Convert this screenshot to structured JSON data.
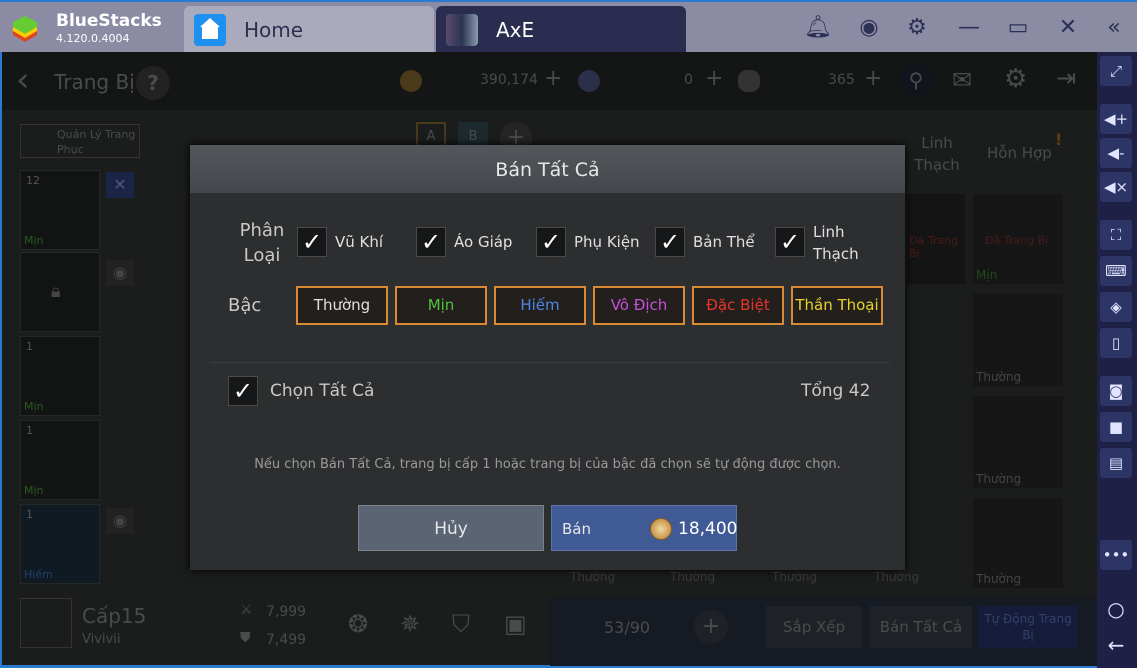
{
  "app": {
    "name": "BlueStacks",
    "version": "4.120.0.4004"
  },
  "tabs": [
    {
      "label": "Home"
    },
    {
      "label": "AxE"
    }
  ],
  "titlebar_icons": [
    "bell-icon",
    "account-icon",
    "gear-icon",
    "minimize-icon",
    "maximize-icon",
    "close-icon",
    "collapse-icon"
  ],
  "game": {
    "title": "Trang Bị",
    "help": "?",
    "gold": "390,174",
    "gems": "0",
    "stones": "365",
    "costume_button": "Quản Lý Trang Phục",
    "preset_tabs": [
      "A",
      "B"
    ],
    "category_tabs": [
      "Linh Thạch",
      "Hỗn Hợp"
    ],
    "equipped_slots": [
      {
        "count": "12",
        "grade": "Mịn"
      },
      {
        "count": "",
        "grade": ""
      },
      {
        "count": "1",
        "grade": "Mịn"
      },
      {
        "count": "1",
        "grade": "Mịn"
      },
      {
        "count": "1",
        "grade": "Hiếm"
      }
    ],
    "inventory_labels": [
      "Đã Trang Bị",
      "Đã Trang Bị",
      "Mịn",
      "Thường",
      "Thường",
      "Thường",
      "Thường",
      "Thường",
      "Thường",
      "Thường"
    ],
    "player": {
      "level": "Cấp15",
      "name": "Vivivii",
      "attack": "7,999",
      "defense": "7,499"
    },
    "capacity": "53/90",
    "sort_button": "Sắp Xếp",
    "sell_all_button": "Bán Tất Cả",
    "auto_equip_button": "Tự Động Trang Bị"
  },
  "dialog": {
    "title": "Bán Tất Cả",
    "category_label": "Phân Loại",
    "categories": [
      {
        "label": "Vũ Khí",
        "checked": true
      },
      {
        "label": "Áo Giáp",
        "checked": true
      },
      {
        "label": "Phụ Kiện",
        "checked": true
      },
      {
        "label": "Bản Thể",
        "checked": true
      },
      {
        "label": "Linh Thạch",
        "checked": true
      }
    ],
    "grade_label": "Bậc",
    "grades": [
      {
        "label": "Thường",
        "color": "#e0e0e0"
      },
      {
        "label": "Mịn",
        "color": "#4fc23c"
      },
      {
        "label": "Hiếm",
        "color": "#4d86e8"
      },
      {
        "label": "Vô Địch",
        "color": "#c84fd8"
      },
      {
        "label": "Đặc Biệt",
        "color": "#e8352c"
      },
      {
        "label": "Thần Thoại",
        "color": "#e8d22a"
      }
    ],
    "select_all": {
      "label": "Chọn Tất Cả",
      "checked": true
    },
    "total": "Tổng 42",
    "note": "Nếu chọn Bán Tất Cả, trang bị cấp 1 hoặc trang bị của bậc đã chọn sẽ tự động được chọn.",
    "cancel": "Hủy",
    "sell": "Bán",
    "sell_price": "18,400"
  },
  "sidebar_icons": [
    "fullscreen-icon",
    "volume-up-icon",
    "volume-down-icon",
    "mute-icon",
    "screen-resize-icon",
    "keyboard-icon",
    "controls-icon",
    "portrait-icon",
    "screenshot-icon",
    "record-icon",
    "media-icon",
    "more-icon",
    "home-icon",
    "back-icon"
  ],
  "colors": {
    "accent": "#2a7bd0",
    "sell_button": "#3f5a95",
    "cancel_button": "#5b6472",
    "grade_border": "#d88a35"
  }
}
